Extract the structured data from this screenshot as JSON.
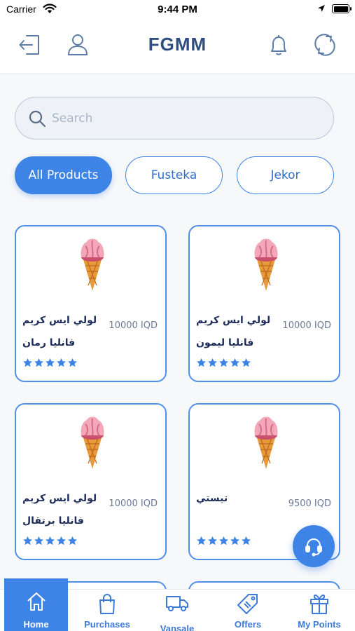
{
  "status_bar": {
    "carrier": "Carrier",
    "time": "9:44 PM"
  },
  "header": {
    "title": "FGMM",
    "icons": [
      "logout-icon",
      "user-icon",
      "bell-icon",
      "refresh-icon"
    ]
  },
  "search": {
    "placeholder": "Search",
    "value": ""
  },
  "filters": [
    {
      "label": "All Products",
      "active": true
    },
    {
      "label": "Fusteka",
      "active": false
    },
    {
      "label": "Jekor",
      "active": false
    }
  ],
  "products": [
    {
      "name": "لولي ايس كريم فانليا رمان",
      "price": "10000 IQD",
      "rating": 5
    },
    {
      "name": "لولي ايس كريم فانليا ليمون",
      "price": "10000 IQD",
      "rating": 5
    },
    {
      "name": "لولي ايس كريم فانليا برتقال",
      "price": "10000 IQD",
      "rating": 5
    },
    {
      "name": "تيستي",
      "price": "9500 IQD",
      "rating": 5
    }
  ],
  "support": {
    "icon": "headset-icon"
  },
  "tabs": [
    {
      "label": "Home",
      "icon": "home-icon",
      "active": true
    },
    {
      "label": "Purchases",
      "icon": "shopping-bag-icon",
      "active": false
    },
    {
      "label": "Vansale",
      "icon": "truck-icon",
      "active": false
    },
    {
      "label": "Offers",
      "icon": "tag-icon",
      "active": false
    },
    {
      "label": "My Points",
      "icon": "gift-icon",
      "active": false
    }
  ],
  "colors": {
    "accent": "#3e84e6",
    "title": "#2f4d7e",
    "text": "#1c2b5a",
    "star": "#3e84e6"
  }
}
